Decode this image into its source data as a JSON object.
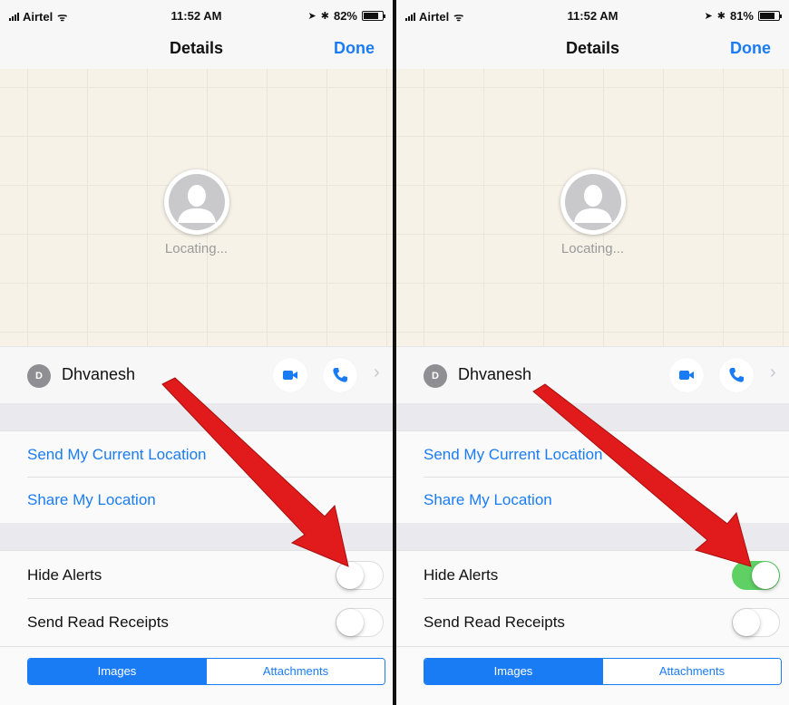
{
  "accent_color": "#1a7cf5",
  "toggle_on_color": "#5fd064",
  "arrow_color": "#e11b1b",
  "panels": [
    {
      "status": {
        "carrier": "Airtel",
        "time": "11:52 AM",
        "battery": "82%",
        "battery_level": 0.82
      },
      "nav": {
        "title": "Details",
        "done": "Done"
      },
      "map": {
        "locating": "Locating..."
      },
      "contact": {
        "initial": "D",
        "name": "Dhvanesh"
      },
      "links": {
        "send_location": "Send My Current Location",
        "share_location": "Share My Location"
      },
      "toggles": {
        "hide_alerts": "Hide Alerts",
        "hide_alerts_on": false,
        "read_receipts": "Send Read Receipts",
        "read_receipts_on": false
      },
      "segments": {
        "images": "Images",
        "attachments": "Attachments",
        "selected": "Images"
      }
    },
    {
      "status": {
        "carrier": "Airtel",
        "time": "11:52 AM",
        "battery": "81%",
        "battery_level": 0.81
      },
      "nav": {
        "title": "Details",
        "done": "Done"
      },
      "map": {
        "locating": "Locating..."
      },
      "contact": {
        "initial": "D",
        "name": "Dhvanesh"
      },
      "links": {
        "send_location": "Send My Current Location",
        "share_location": "Share My Location"
      },
      "toggles": {
        "hide_alerts": "Hide Alerts",
        "hide_alerts_on": true,
        "read_receipts": "Send Read Receipts",
        "read_receipts_on": false
      },
      "segments": {
        "images": "Images",
        "attachments": "Attachments",
        "selected": "Images"
      }
    }
  ],
  "icons": [
    "signal-icon",
    "wifi-icon",
    "location-icon",
    "bluetooth-icon",
    "battery-icon",
    "person-silhouette-icon",
    "video-camera-icon",
    "phone-icon",
    "chevron-right-icon",
    "red-arrow-icon"
  ]
}
